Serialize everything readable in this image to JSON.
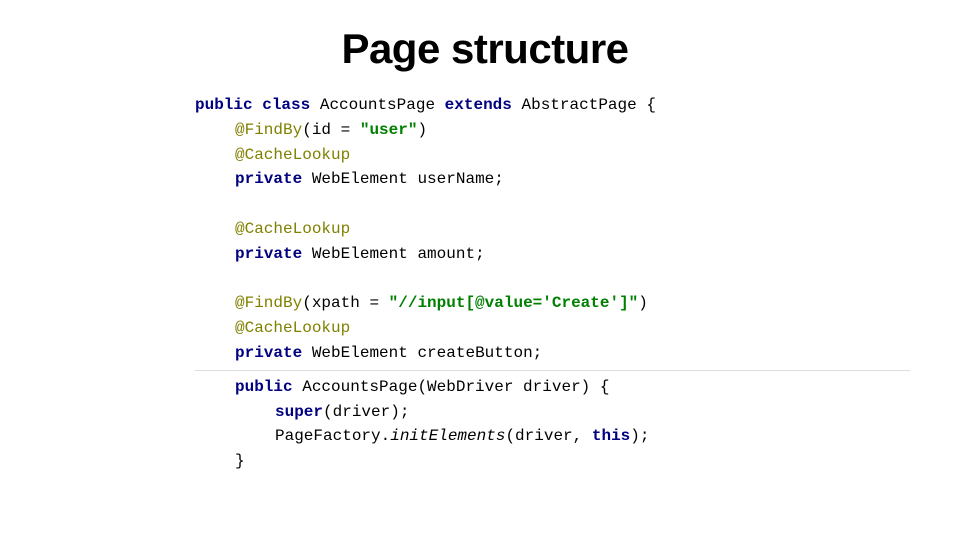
{
  "title": "Page structure",
  "code": {
    "l1": {
      "kw1": "public",
      "kw2": "class",
      "name": "AccountsPage",
      "kw3": "extends",
      "parent": "AbstractPage",
      "brace": "{"
    },
    "l2": {
      "ann": "@FindBy",
      "paren_open": "(",
      "param": "id = ",
      "str": "\"user\"",
      "paren_close": ")"
    },
    "l3": {
      "ann": "@CacheLookup"
    },
    "l4": {
      "kw": "private",
      "type": "WebElement",
      "name": "userName",
      "semi": ";"
    },
    "l5": {
      "ann": "@CacheLookup"
    },
    "l6": {
      "kw": "private",
      "type": "WebElement",
      "name": "amount",
      "semi": ";"
    },
    "l7": {
      "ann": "@FindBy",
      "paren_open": "(",
      "param": "xpath = ",
      "str": "\"//input[@value='Create']\"",
      "paren_close": ")"
    },
    "l8": {
      "ann": "@CacheLookup"
    },
    "l9": {
      "kw": "private",
      "type": "WebElement",
      "name": "createButton",
      "semi": ";"
    },
    "l10": {
      "kw": "public",
      "name": "AccountsPage",
      "rest": "(WebDriver driver) {"
    },
    "l11": {
      "kw": "super",
      "rest": "(driver);"
    },
    "l12": {
      "pre": "PageFactory.",
      "italic": "initElements",
      "post_open": "(driver, ",
      "kw": "this",
      "post_close": ");"
    },
    "l13": {
      "brace": "}"
    }
  }
}
